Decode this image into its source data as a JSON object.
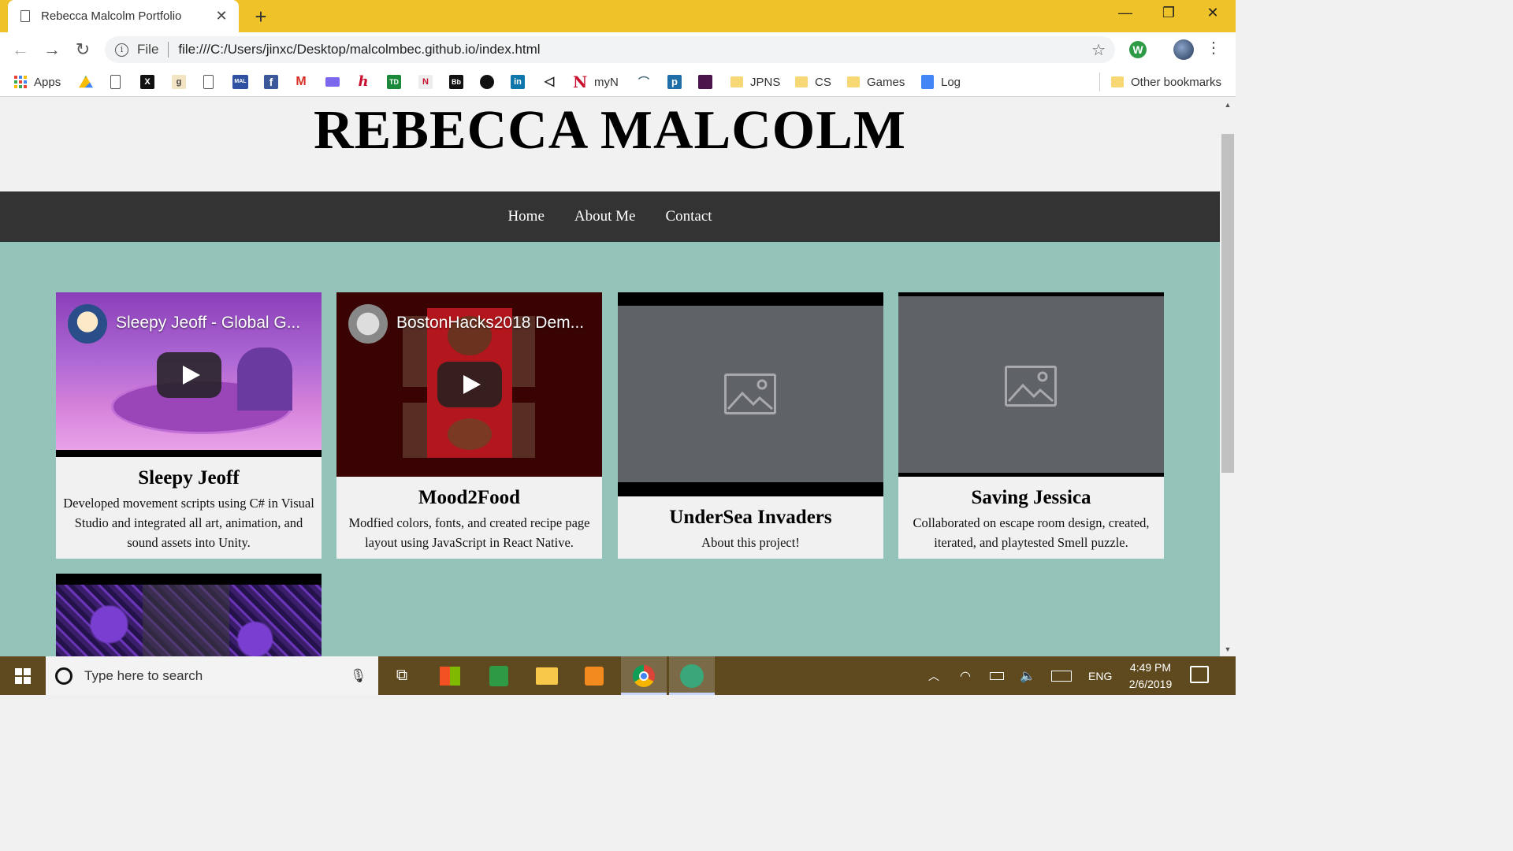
{
  "browser": {
    "tab_title": "Rebecca Malcolm Portfolio",
    "omnibox_scheme": "File",
    "url": "file:///C:/Users/jinxc/Desktop/malcolmbec.github.io/index.html",
    "extension_letter": "W"
  },
  "bookmarks": {
    "apps": "Apps",
    "myn": "myN",
    "jpns": "JPNS",
    "cs": "CS",
    "games": "Games",
    "log": "Log",
    "other": "Other bookmarks",
    "glyphs": {
      "g": "g",
      "x": "X",
      "mal": "MAL",
      "fb": "f",
      "gmail": "M",
      "h": "h",
      "td": "TD",
      "n1": "N",
      "bb": "Bb",
      "in": "in",
      "n2": "N",
      "p": "p"
    }
  },
  "site": {
    "title": "REBECCA MALCOLM",
    "nav": [
      "Home",
      "About Me",
      "Contact"
    ],
    "projects": [
      {
        "title": "Sleepy Jeoff",
        "desc": "Developed movement scripts using C# in Visual Studio and integrated all art, animation, and sound assets into Unity.",
        "video_title": "Sleepy Jeoff - Global G..."
      },
      {
        "title": "Mood2Food",
        "desc": "Modfied colors, fonts, and created recipe page layout using JavaScript in React Native.",
        "video_title": "BostonHacks2018 Dem..."
      },
      {
        "title": "UnderSea Invaders",
        "desc": "About this project!"
      },
      {
        "title": "Saving Jessica",
        "desc": "Collaborated on escape room design, created, iterated, and playtested Smell puzzle."
      }
    ]
  },
  "taskbar": {
    "search_placeholder": "Type here to search",
    "language": "ENG",
    "time": "4:49 PM",
    "date": "2/6/2019"
  }
}
